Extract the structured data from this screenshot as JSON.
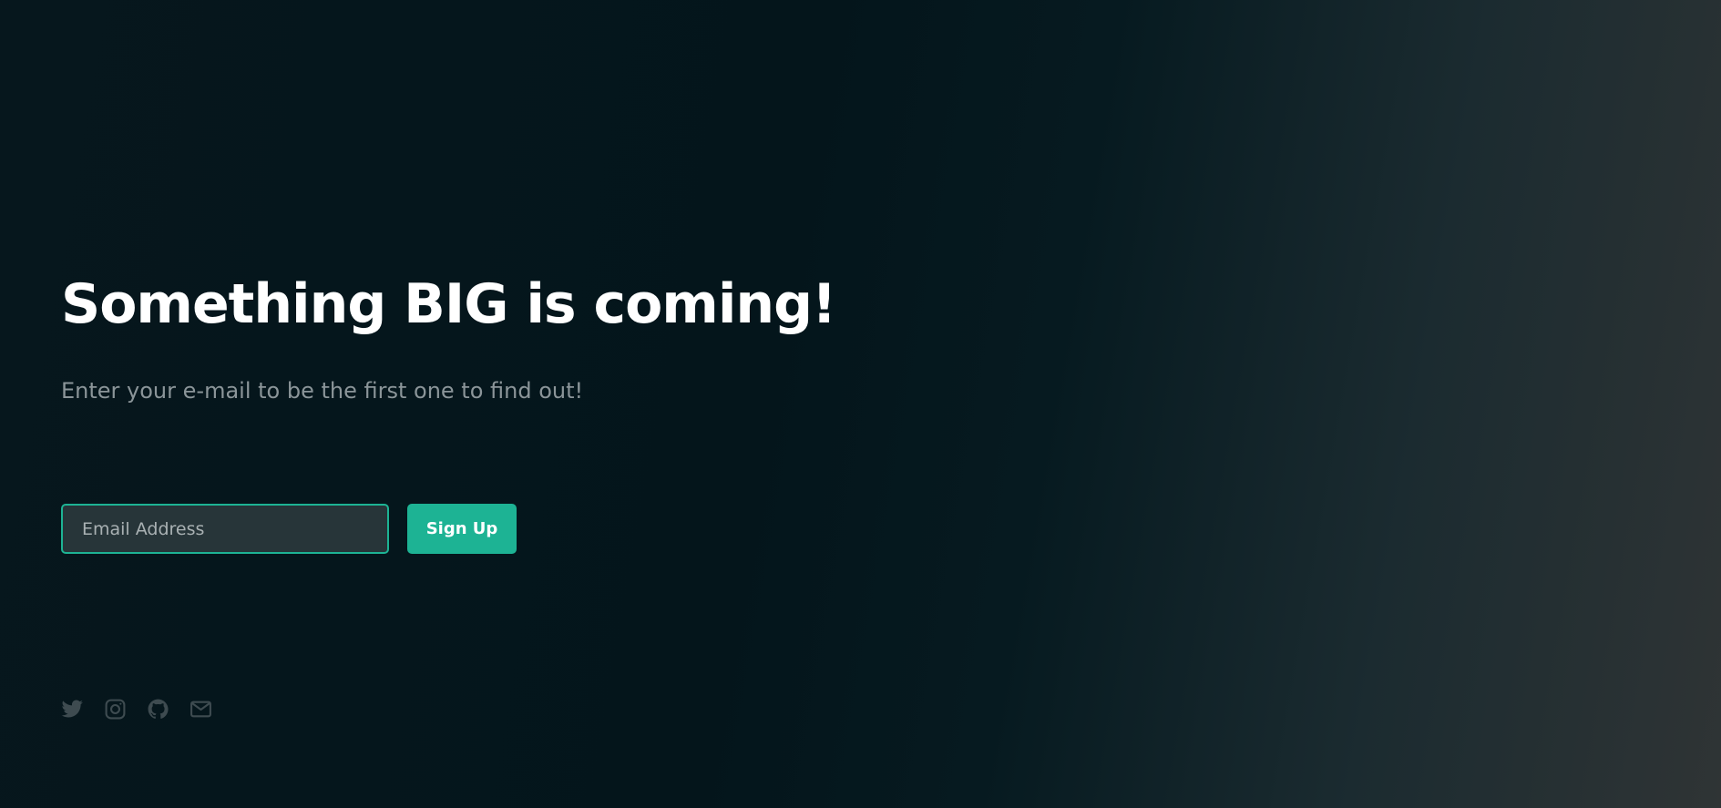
{
  "hero": {
    "headline": "Something BIG is coming!",
    "subtitle": "Enter your e-mail to be the first one to find out!"
  },
  "signup_form": {
    "email_placeholder": "Email Address",
    "email_value": "",
    "submit_label": "Sign Up"
  },
  "social_links": [
    {
      "icon": "twitter-icon"
    },
    {
      "icon": "instagram-icon"
    },
    {
      "icon": "github-icon"
    },
    {
      "icon": "envelope-icon"
    }
  ],
  "colors": {
    "accent": "#1db394",
    "background_dark": "#04151b",
    "background_light": "#2f3435",
    "headline": "#ffffff",
    "subtitle": "#8b9599",
    "icon": "#3e4b50",
    "input_background": "#273539"
  }
}
